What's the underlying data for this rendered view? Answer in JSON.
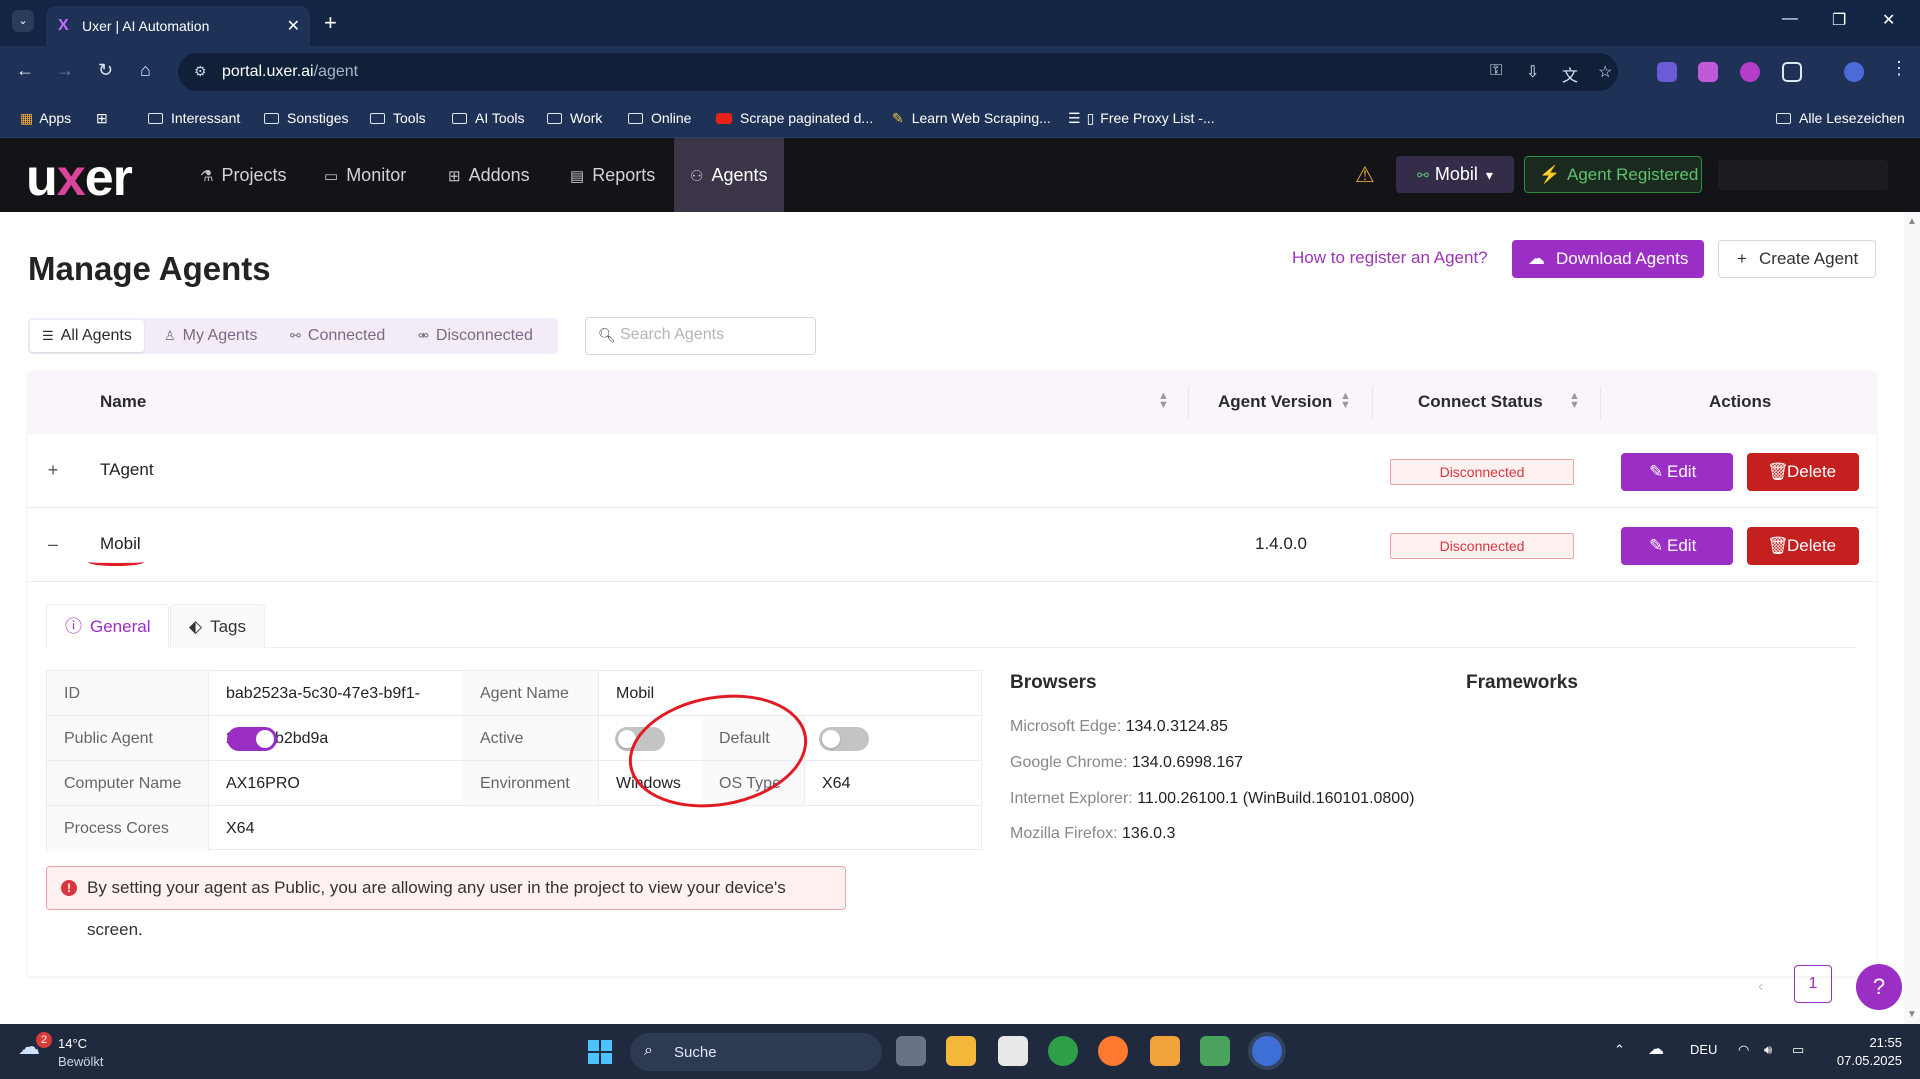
{
  "browser": {
    "tab_title": "Uxer | AI Automation",
    "url_host": "portal.uxer.ai",
    "url_path": "/agent",
    "bookmarks": [
      "Apps",
      "Interessant",
      "Sonstiges",
      "Tools",
      "AI Tools",
      "Work",
      "Online",
      "Scrape paginated d...",
      "Learn Web Scraping...",
      "Free Proxy List -...",
      "Alle Lesezeichen"
    ]
  },
  "appnav": {
    "logo": "uxer",
    "items": [
      "Projects",
      "Monitor",
      "Addons",
      "Reports",
      "Agents"
    ],
    "active": "Agents",
    "agent_selector": "Mobil",
    "agent_status": "Agent Registered"
  },
  "page": {
    "title": "Manage Agents",
    "how_link": "How to register an Agent?",
    "download_button": "Download Agents",
    "create_button": "Create Agent",
    "filters": [
      "All Agents",
      "My Agents",
      "Connected",
      "Disconnected"
    ],
    "search_placeholder": "Search Agents"
  },
  "table": {
    "columns": [
      "Name",
      "Agent Version",
      "Connect Status",
      "Actions"
    ],
    "rows": [
      {
        "expander": "+",
        "name": "TAgent",
        "version": "",
        "status": "Disconnected",
        "edit": "Edit",
        "delete": "Delete"
      },
      {
        "expander": "–",
        "name": "Mobil",
        "version": "1.4.0.0",
        "status": "Disconnected",
        "edit": "Edit",
        "delete": "Delete"
      }
    ]
  },
  "details": {
    "tabs": [
      "General",
      "Tags"
    ],
    "id_label": "ID",
    "id_value": "bab2523a-5c30-47e3-b9f1-215f51b2bd9a",
    "agent_name_label": "Agent Name",
    "agent_name_value": "Mobil",
    "public_label": "Public Agent",
    "public_on": true,
    "active_label": "Active",
    "active_on": false,
    "default_label": "Default",
    "default_on": false,
    "computer_label": "Computer Name",
    "computer_value": "AX16PRO",
    "env_label": "Environment",
    "env_value": "Windows",
    "os_label": "OS Type",
    "os_value": "X64",
    "cores_label": "Process Cores",
    "cores_value": "X64",
    "browsers_title": "Browsers",
    "frameworks_title": "Frameworks",
    "browsers": [
      {
        "name": "Microsoft Edge:",
        "version": "134.0.3124.85"
      },
      {
        "name": "Google Chrome:",
        "version": "134.0.6998.167"
      },
      {
        "name": "Internet Explorer:",
        "version": "11.00.26100.1 (WinBuild.160101.0800)"
      },
      {
        "name": "Mozilla Firefox:",
        "version": "136.0.3"
      }
    ],
    "alert": "By setting your agent as Public, you are allowing any user in the project to view your device's screen."
  },
  "pagination": {
    "current": "1"
  },
  "help": "?",
  "taskbar": {
    "temp": "14°C",
    "weather": "Bewölkt",
    "weather_badge": "2",
    "search": "Suche",
    "lang": "DEU",
    "time": "21:55",
    "date": "07.05.2025"
  },
  "colors": {
    "accent": "#9b2fc5",
    "danger": "#c4201f",
    "nav_bg": "#131418"
  }
}
